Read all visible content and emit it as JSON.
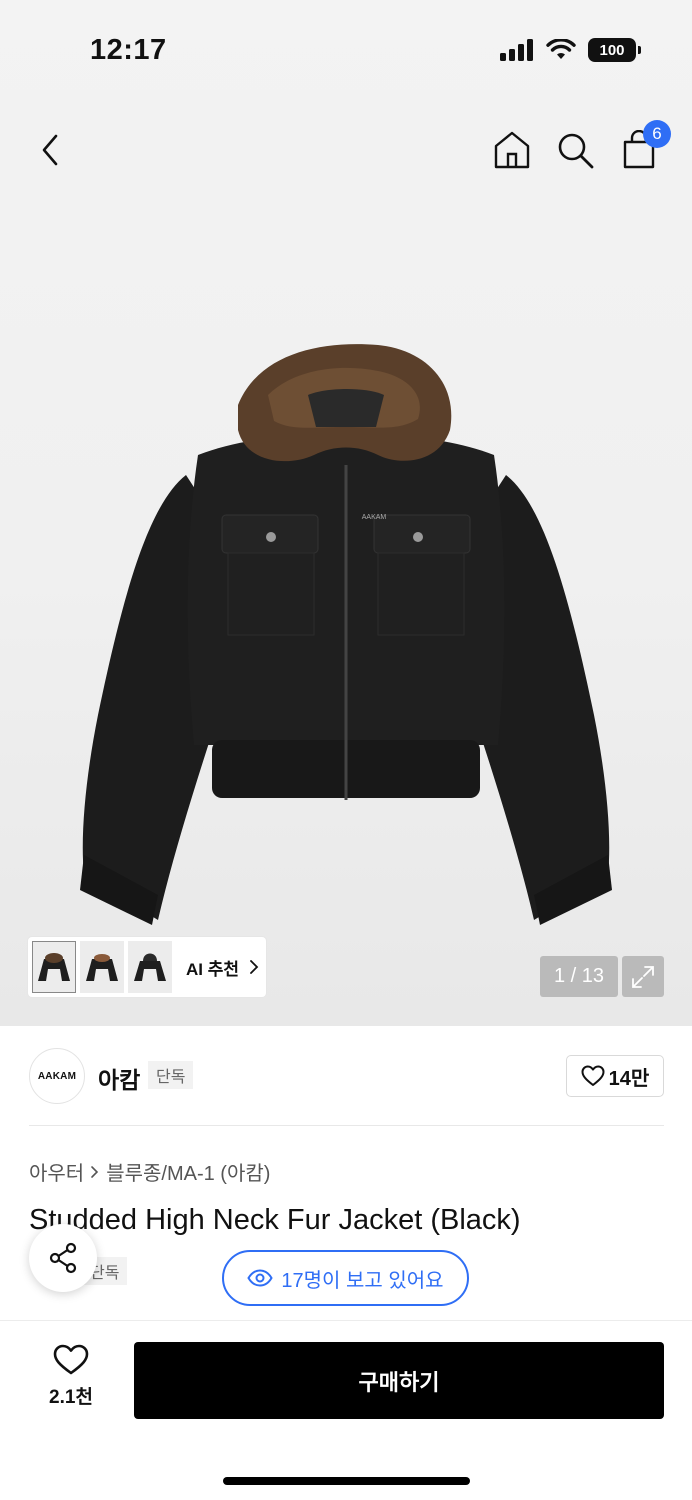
{
  "status_bar": {
    "time": "12:17",
    "battery": "100"
  },
  "nav": {
    "cart_count": "6"
  },
  "gallery": {
    "ai_label": "AI 추천",
    "pager": "1 / 13",
    "jacket_logo_text": "AAKAM"
  },
  "brand": {
    "logo_text": "AAKAM",
    "name": "아캄",
    "tag": "단독",
    "likes": "14만"
  },
  "breadcrumb": {
    "category": "아우터",
    "subcategory": "블루종/MA-1 (아캄)"
  },
  "product": {
    "title": "Studded High Neck Fur Jacket (Black)",
    "tag": "단독"
  },
  "viewers": {
    "text": "17명이 보고 있어요"
  },
  "bottom": {
    "wish_count": "2.1천",
    "buy_label": "구매하기"
  },
  "colors": {
    "accent": "#2f6ef5",
    "buy_button": "#000000"
  }
}
